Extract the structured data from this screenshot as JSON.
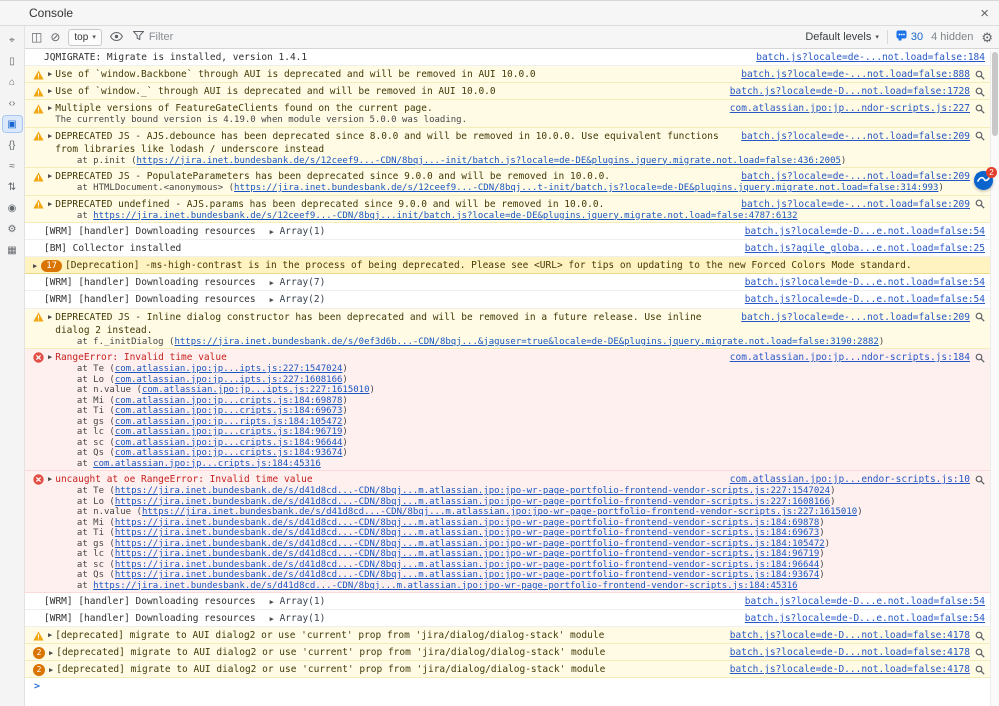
{
  "window": {
    "title": "Console"
  },
  "icons": {
    "sidebar_toggle": "◫",
    "clear": "⊘",
    "caret": "▾",
    "close": "×",
    "settings": "⚙",
    "expander": "▶",
    "prompt_chevron": ">"
  },
  "sidebar": {
    "icons": [
      {
        "name": "inspect",
        "glyph": "⌖",
        "active": false
      },
      {
        "name": "device-emulation",
        "glyph": "▯",
        "active": false
      },
      {
        "name": "home",
        "glyph": "⌂",
        "active": false
      },
      {
        "name": "elements",
        "glyph": "‹›",
        "active": false
      },
      {
        "name": "console",
        "glyph": "▣",
        "active": true
      },
      {
        "name": "sources",
        "glyph": "{}",
        "active": false
      },
      {
        "name": "network",
        "glyph": "≈",
        "active": false
      },
      {
        "name": "performance",
        "glyph": "⇅",
        "active": false
      },
      {
        "name": "memory",
        "glyph": "◉",
        "active": false
      },
      {
        "name": "settings",
        "glyph": "⚙",
        "active": false
      },
      {
        "name": "storage",
        "glyph": "▦",
        "active": false
      }
    ]
  },
  "toolbar": {
    "context": "top",
    "filter_placeholder": "Filter",
    "levels_label": "Default levels",
    "issues_count": "30",
    "hidden_label": "4 hidden"
  },
  "messages": [
    {
      "level": "log",
      "icon": "none",
      "expander": false,
      "text": "JQMIGRATE: Migrate is installed, version 1.4.1",
      "source": "batch.js?locale=de-...not.load=false:184",
      "search_icon": false
    },
    {
      "level": "warn",
      "icon": "warning",
      "expander": true,
      "text": "Use of `window.Backbone` through AUI is deprecated and will be removed in AUI 10.0.0",
      "source": "batch.js?locale=de-...not.load=false:888",
      "search_icon": true
    },
    {
      "level": "warn",
      "icon": "warning",
      "expander": true,
      "text": "Use of `window._` through AUI is deprecated and will be removed in AUI 10.0.0",
      "source": "batch.js?locale=de-D...not.load=false:1728",
      "search_icon": true
    },
    {
      "level": "warn",
      "icon": "warning",
      "expander": true,
      "text": "Multiple versions of FeatureGateClients found on the current page.",
      "lines": [
        {
          "pre": "The currently bound version is 4.19.0 when module version 5.0.0 was loading."
        }
      ],
      "source": "com.atlassian.jpo:jp...ndor-scripts.js:227",
      "search_icon": true
    },
    {
      "level": "warn",
      "icon": "warning",
      "expander": true,
      "text": "DEPRECATED JS - AJS.debounce has been deprecated since 8.0.0 and will be removed in 10.0.0. Use equivalent functions from libraries like lodash / underscore instead",
      "lines": [
        {
          "pre": "    at p.init (",
          "link": "https://jira.inet.bundesbank.de/s/12ceef9...-CDN/8bqj...-init/batch.js?locale=de-DE&plugins.jquery.migrate.not.load=false:436:2005",
          "post": ")"
        }
      ],
      "source": "batch.js?locale=de-...not.load=false:209",
      "search_icon": true
    },
    {
      "level": "warn",
      "icon": "warning",
      "expander": true,
      "text": "DEPRECATED JS - PopulateParameters has been deprecated since 9.0.0 and will be removed in 10.0.0.",
      "lines": [
        {
          "pre": "    at HTMLDocument.<anonymous> (",
          "link": "https://jira.inet.bundesbank.de/s/12ceef9...-CDN/8bqj...t-init/batch.js?locale=de-DE&plugins.jquery.migrate.not.load=false:314:993",
          "post": ")"
        }
      ],
      "source": "batch.js?locale=de-...not.load=false:209",
      "search_icon": true
    },
    {
      "level": "warn",
      "icon": "warning",
      "expander": true,
      "text": "DEPRECATED undefined - AJS.params has been deprecated since 9.0.0 and will be removed in 10.0.0.",
      "lines": [
        {
          "pre": "    at ",
          "link": "https://jira.inet.bundesbank.de/s/12ceef9...-CDN/8bqj...init/batch.js?locale=de-DE&plugins.jquery.migrate.not.load=false:4787:6132"
        }
      ],
      "source": "batch.js?locale=de-...not.load=false:209",
      "search_icon": true
    },
    {
      "level": "log",
      "icon": "none",
      "expander": false,
      "text": "[WRM] [handler] Downloading resources",
      "inline_array": "Array(1)",
      "source": "batch.js?locale=de-D...e.not.load=false:54",
      "search_icon": false
    },
    {
      "level": "log",
      "icon": "none",
      "expander": false,
      "text": "[BM] Collector installed",
      "source": "batch.js?agile_globa...e.not.load=false:25",
      "search_icon": false
    },
    {
      "level": "warn",
      "emphasis": true,
      "icon": "none",
      "expander": true,
      "count_badge": {
        "shape": "pill",
        "text": "17"
      },
      "text": "[Deprecation] -ms-high-contrast is in the process of being deprecated. Please see <URL> for tips on updating to the new Forced Colors Mode standard.",
      "source": null,
      "search_icon": false
    },
    {
      "level": "log",
      "icon": "none",
      "expander": false,
      "text": "[WRM] [handler] Downloading resources",
      "inline_array": "Array(7)",
      "source": "batch.js?locale=de-D...e.not.load=false:54",
      "search_icon": false
    },
    {
      "level": "log",
      "icon": "none",
      "expander": false,
      "text": "[WRM] [handler] Downloading resources",
      "inline_array": "Array(2)",
      "source": "batch.js?locale=de-D...e.not.load=false:54",
      "search_icon": false
    },
    {
      "level": "warn",
      "icon": "warning",
      "expander": true,
      "text": "DEPRECATED JS - Inline dialog constructor has been deprecated and will be removed in a future release. Use inline dialog 2 instead.",
      "lines": [
        {
          "pre": "    at f._initDialog (",
          "link": "https://jira.inet.bundesbank.de/s/0ef3d6b...-CDN/8bqj...&jaguser=true&locale=de-DE&plugins.jquery.migrate.not.load=false:3190:2882",
          "post": ")"
        }
      ],
      "source": "batch.js?locale=de-...not.load=false:209",
      "search_icon": true
    },
    {
      "level": "error",
      "icon": "error",
      "expander": true,
      "text": "RangeError: Invalid time value",
      "lines": [
        {
          "pre": "    at Te (",
          "link": "com.atlassian.jpo:jp...ipts.js:227:1547024",
          "post": ")"
        },
        {
          "pre": "    at Lo (",
          "link": "com.atlassian.jpo:jp...ipts.js:227:1608166",
          "post": ")"
        },
        {
          "pre": "    at n.value (",
          "link": "com.atlassian.jpo:jp...ipts.js:227:1615010",
          "post": ")"
        },
        {
          "pre": "    at Mi (",
          "link": "com.atlassian.jpo:jp...cripts.js:184:69878",
          "post": ")"
        },
        {
          "pre": "    at Ti (",
          "link": "com.atlassian.jpo:jp...cripts.js:184:69673",
          "post": ")"
        },
        {
          "pre": "    at gs (",
          "link": "com.atlassian.jpo:jp...ripts.js:184:105472",
          "post": ")"
        },
        {
          "pre": "    at lc (",
          "link": "com.atlassian.jpo:jp...cripts.js:184:96719",
          "post": ")"
        },
        {
          "pre": "    at sc (",
          "link": "com.atlassian.jpo:jp...cripts.js:184:96644",
          "post": ")"
        },
        {
          "pre": "    at Qs (",
          "link": "com.atlassian.jpo:jp...cripts.js:184:93674",
          "post": ")"
        },
        {
          "pre": "    at ",
          "link": "com.atlassian.jpo:jp...cripts.js:184:45316"
        }
      ],
      "source": "com.atlassian.jpo:jp...ndor-scripts.js:184",
      "search_icon": true
    },
    {
      "level": "error",
      "icon": "error",
      "expander": true,
      "text": "uncaught at oe RangeError: Invalid time value",
      "lines": [
        {
          "pre": "    at Te (",
          "link": "https://jira.inet.bundesbank.de/s/d41d8cd...-CDN/8bqj...m.atlassian.jpo:jpo-wr-page-portfolio-frontend-vendor-scripts.js:227:1547024",
          "post": ")"
        },
        {
          "pre": "    at Lo (",
          "link": "https://jira.inet.bundesbank.de/s/d41d8cd...-CDN/8bqj...m.atlassian.jpo:jpo-wr-page-portfolio-frontend-vendor-scripts.js:227:1608166",
          "post": ")"
        },
        {
          "pre": "    at n.value (",
          "link": "https://jira.inet.bundesbank.de/s/d41d8cd...-CDN/8bqj...m.atlassian.jpo:jpo-wr-page-portfolio-frontend-vendor-scripts.js:227:1615010",
          "post": ")"
        },
        {
          "pre": "    at Mi (",
          "link": "https://jira.inet.bundesbank.de/s/d41d8cd...-CDN/8bqj...m.atlassian.jpo:jpo-wr-page-portfolio-frontend-vendor-scripts.js:184:69878",
          "post": ")"
        },
        {
          "pre": "    at Ti (",
          "link": "https://jira.inet.bundesbank.de/s/d41d8cd...-CDN/8bqj...m.atlassian.jpo:jpo-wr-page-portfolio-frontend-vendor-scripts.js:184:69673",
          "post": ")"
        },
        {
          "pre": "    at gs (",
          "link": "https://jira.inet.bundesbank.de/s/d41d8cd...-CDN/8bqj...m.atlassian.jpo:jpo-wr-page-portfolio-frontend-vendor-scripts.js:184:105472",
          "post": ")"
        },
        {
          "pre": "    at lc (",
          "link": "https://jira.inet.bundesbank.de/s/d41d8cd...-CDN/8bqj...m.atlassian.jpo:jpo-wr-page-portfolio-frontend-vendor-scripts.js:184:96719",
          "post": ")"
        },
        {
          "pre": "    at sc (",
          "link": "https://jira.inet.bundesbank.de/s/d41d8cd...-CDN/8bqj...m.atlassian.jpo:jpo-wr-page-portfolio-frontend-vendor-scripts.js:184:96644",
          "post": ")"
        },
        {
          "pre": "    at Qs (",
          "link": "https://jira.inet.bundesbank.de/s/d41d8cd...-CDN/8bqj...m.atlassian.jpo:jpo-wr-page-portfolio-frontend-vendor-scripts.js:184:93674",
          "post": ")"
        },
        {
          "pre": "    at ",
          "link": "https://jira.inet.bundesbank.de/s/d41d8cd...-CDN/8bqj...m.atlassian.jpo:jpo-wr-page-portfolio-frontend-vendor-scripts.js:184:45316"
        }
      ],
      "source": "com.atlassian.jpo:jp...endor-scripts.js:10",
      "search_icon": true
    },
    {
      "level": "log",
      "icon": "none",
      "expander": false,
      "text": "[WRM] [handler] Downloading resources",
      "inline_array": "Array(1)",
      "source": "batch.js?locale=de-D...e.not.load=false:54",
      "search_icon": false
    },
    {
      "level": "log",
      "icon": "none",
      "expander": false,
      "text": "[WRM] [handler] Downloading resources",
      "inline_array": "Array(1)",
      "source": "batch.js?locale=de-D...e.not.load=false:54",
      "search_icon": false
    },
    {
      "level": "warn",
      "icon": "warning",
      "expander": true,
      "text": "[deprecated] migrate to AUI dialog2 or use 'current' prop from 'jira/dialog/dialog-stack' module",
      "source": "batch.js?locale=de-D...not.load=false:4178",
      "search_icon": true
    },
    {
      "level": "warn",
      "icon": "none",
      "expander": true,
      "count_badge": {
        "shape": "circle",
        "text": "2"
      },
      "text": "[deprecated] migrate to AUI dialog2 or use 'current' prop from 'jira/dialog/dialog-stack' module",
      "source": "batch.js?locale=de-D...not.load=false:4178",
      "search_icon": true
    },
    {
      "level": "warn",
      "icon": "none",
      "expander": true,
      "count_badge": {
        "shape": "circle",
        "text": "2"
      },
      "text": "[deprecated] migrate to AUI dialog2 or use 'current' prop from 'jira/dialog/dialog-stack' module",
      "source": "batch.js?locale=de-D...not.load=false:4178",
      "search_icon": true
    }
  ],
  "widget": {
    "badge": "2"
  }
}
